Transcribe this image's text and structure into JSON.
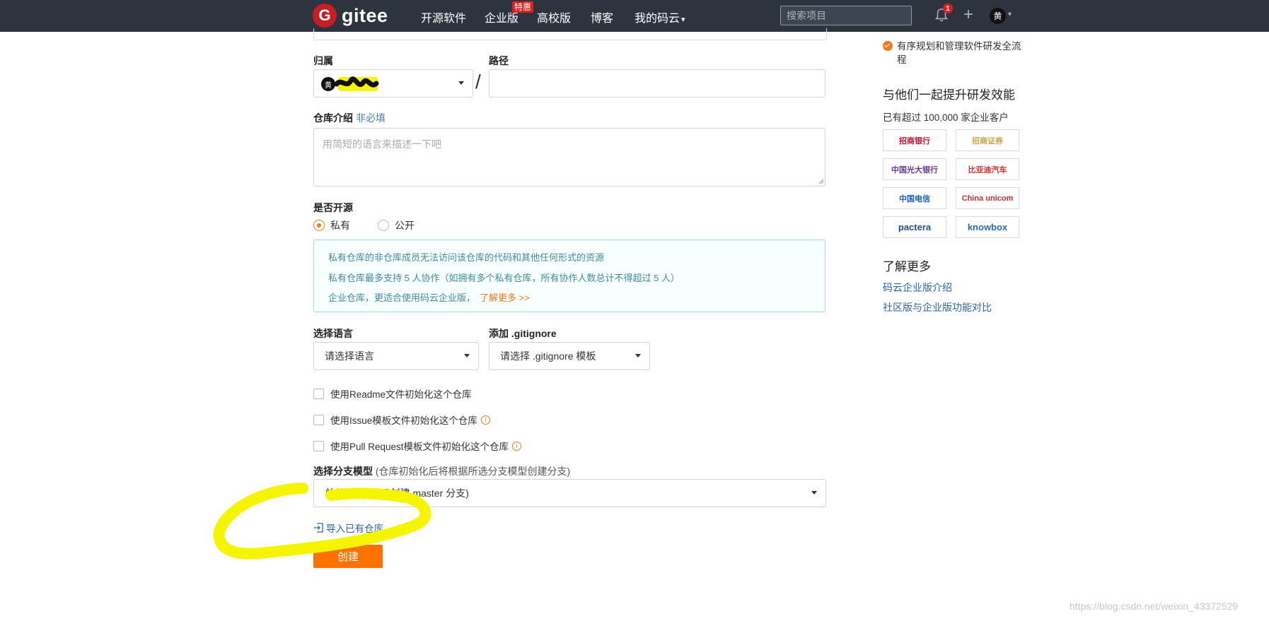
{
  "nav": {
    "logo_letter": "G",
    "logo_text": "gitee",
    "items": [
      "开源软件",
      "企业版",
      "高校版",
      "博客",
      "我的码云"
    ],
    "enterprise_badge": "特惠",
    "search_placeholder": "搜索项目",
    "notification_count": "1",
    "plus": "+",
    "avatar": "黄",
    "caret": "▾"
  },
  "form": {
    "owner_label": "归属",
    "owner_avatar": "黄",
    "path_label": "路径",
    "path_value": "",
    "path_slash": "/",
    "intro_label": "仓库介绍",
    "intro_optional": "非必填",
    "intro_placeholder": "用简短的语言来描述一下吧",
    "open_source_label": "是否开源",
    "visibility_options": [
      "私有",
      "公开"
    ],
    "visibility_selected": "私有",
    "info_lines": [
      "私有仓库的非仓库成员无法访问该仓库的代码和其他任何形式的资源",
      "私有仓库最多支持 5 人协作（如拥有多个私有仓库，所有协作人数总计不得超过 5 人）",
      "企业仓库，更适合使用码云企业版，"
    ],
    "info_link": "了解更多 >>",
    "language_label": "选择语言",
    "language_value": "请选择语言",
    "gitignore_label": "添加 .gitignore",
    "gitignore_value": "请选择 .gitignore 模板",
    "checkboxes": [
      "使用Readme文件初始化这个仓库",
      "使用Issue模板文件初始化这个仓库",
      "使用Pull Request模板文件初始化这个仓库"
    ],
    "info_icon": "i",
    "branch_label": "选择分支模型",
    "branch_note": "(仓库初始化后将根据所选分支模型创建分支)",
    "branch_value": "单分支模型 (只创建 master 分支)",
    "import_link": "导入已有仓库",
    "create_button": "创建"
  },
  "sidebar": {
    "feature": "有序规划和管理软件研发全流程",
    "promo_heading": "与他们一起提升研发效能",
    "promo_sub": "已有超过 100,000 家企业客户",
    "customer_logos": [
      {
        "text": "招商银行",
        "color": "#c8102e"
      },
      {
        "text": "招商证券",
        "color": "#c9a34a"
      },
      {
        "text": "中国光大银行",
        "color": "#6b3a8f"
      },
      {
        "text": "比亚迪汽车",
        "color": "#d62d2d"
      },
      {
        "text": "中国电信",
        "color": "#1a5fb4"
      },
      {
        "text": "China unicom",
        "color": "#d62d2d"
      },
      {
        "text": "pactera",
        "color": "#1d4e89"
      },
      {
        "text": "knowbox",
        "color": "#2d6ab3"
      }
    ],
    "learn_more_heading": "了解更多",
    "links": [
      "码云企业版介绍",
      "社区版与企业版功能对比"
    ]
  },
  "watermark": "https://blog.csdn.net/weixin_43372529"
}
